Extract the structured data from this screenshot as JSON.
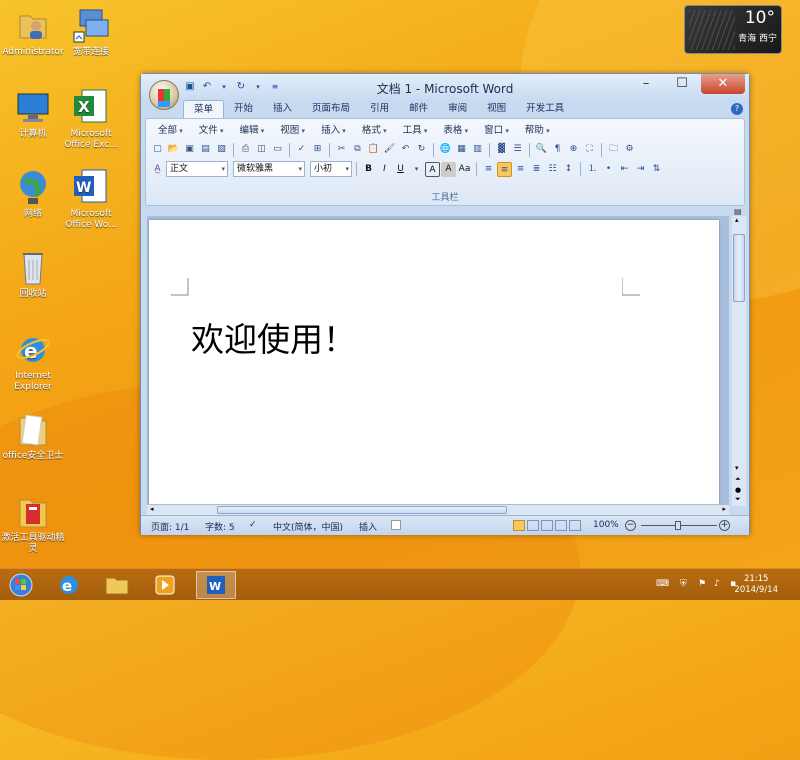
{
  "desktop_icons": [
    {
      "label": "Administrator",
      "icon": "user-folder-icon"
    },
    {
      "label": "宽带连接",
      "icon": "broadband-connection-icon"
    },
    {
      "label": "计算机",
      "icon": "computer-icon"
    },
    {
      "label": "Microsoft Office Exc...",
      "icon": "excel-icon"
    },
    {
      "label": "网络",
      "icon": "network-icon"
    },
    {
      "label": "Microsoft Office Wo...",
      "icon": "word-icon"
    },
    {
      "label": "回收站",
      "icon": "recycle-bin-icon"
    },
    {
      "label": "Internet Explorer",
      "icon": "ie-icon"
    },
    {
      "label": "office安全卫士",
      "icon": "folder-icon"
    },
    {
      "label": "激活工具驱动精灵",
      "icon": "activation-tool-icon"
    }
  ],
  "weather": {
    "temp": "10°",
    "city": "青海 西宁"
  },
  "window": {
    "title": "文档 1 - Microsoft Word",
    "tabs": [
      "菜单",
      "开始",
      "插入",
      "页面布局",
      "引用",
      "邮件",
      "审阅",
      "视图",
      "开发工具"
    ],
    "menus": [
      "全部",
      "文件",
      "编辑",
      "视图",
      "插入",
      "格式",
      "工具",
      "表格",
      "窗口",
      "帮助"
    ],
    "style_combo": "正文",
    "font_combo": "微软雅黑",
    "size_combo": "小初",
    "group_label": "工具栏",
    "document_text": "欢迎使用！",
    "status": {
      "page": "页面: 1/1",
      "words": "字数: 5",
      "language": "中文(简体，中国)",
      "mode": "插入",
      "zoom": "100%"
    }
  },
  "taskbar": {
    "time": "21:15",
    "date": "2014/9/14"
  },
  "colors": {
    "accent": "#f4a817",
    "ribbon": "#dde8f6",
    "taskbar": "#a35d0b"
  }
}
